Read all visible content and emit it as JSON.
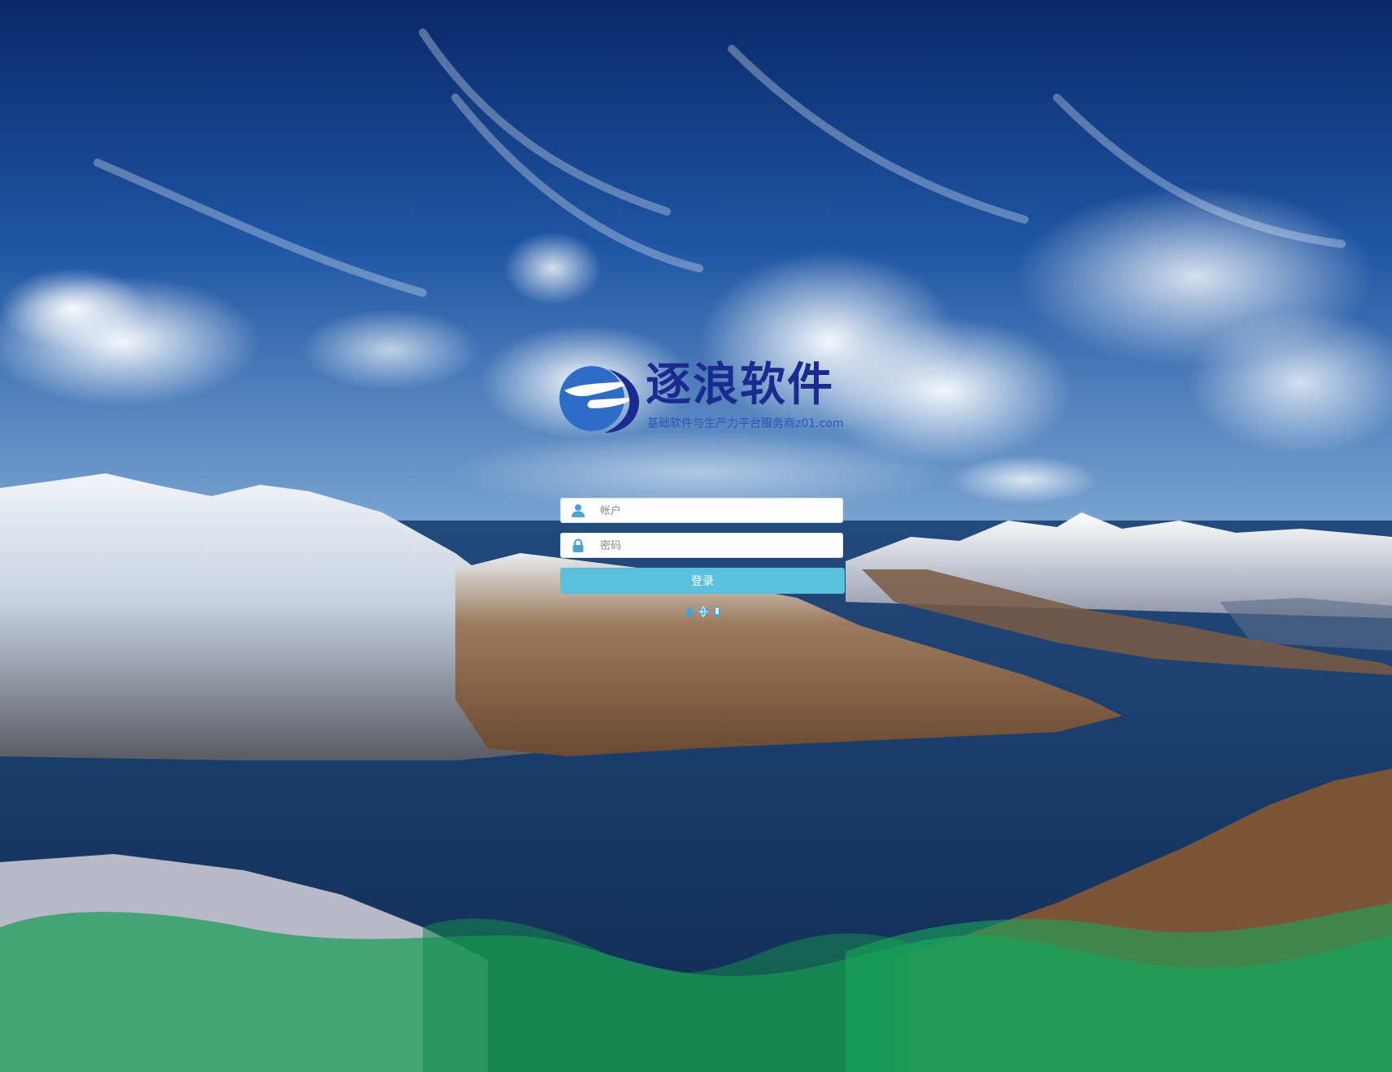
{
  "brand": {
    "title": "逐浪软件",
    "subtitle": "基础软件与生产力平台服务商z01.com",
    "title_color": "#1b2a8f",
    "subtitle_color": "#2c56b8",
    "mark_icon": "wave-globe-logo-icon"
  },
  "login": {
    "account_placeholder": "帐户",
    "password_placeholder": "密码",
    "account_value": "",
    "password_value": "",
    "submit_label": "登录",
    "account_icon": "user-icon",
    "password_icon": "lock-icon",
    "button_color": "#5bc0de",
    "icon_color": "#4aa3d6"
  },
  "social_icons": [
    "home-icon",
    "globe-icon",
    "phone-icon"
  ],
  "background": {
    "sky_color": "#1b4f9e",
    "lake_color": "#14355e",
    "wave_color": "#1f9e5a"
  }
}
